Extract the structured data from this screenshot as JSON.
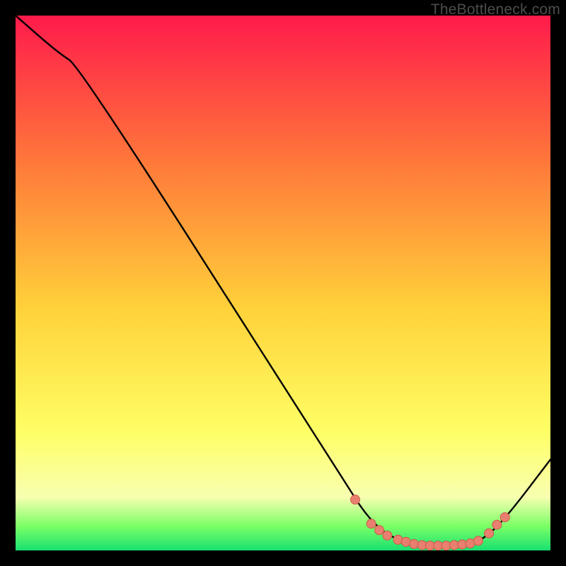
{
  "watermark": "TheBottleneck.com",
  "colors": {
    "bg": "#000000",
    "grad_top": "#ff1a4b",
    "grad_mid_upper": "#ff7a3a",
    "grad_mid": "#ffd23a",
    "grad_low": "#ffff66",
    "grad_bright": "#f8ffb0",
    "grad_green1": "#7aff66",
    "grad_green2": "#18e070",
    "curve": "#000000",
    "marker_fill": "#e9806f",
    "marker_stroke": "#c95a49"
  },
  "chart_data": {
    "type": "line",
    "title": "",
    "xlabel": "",
    "ylabel": "",
    "xlim": [
      0,
      100
    ],
    "ylim": [
      0,
      100
    ],
    "curve": [
      {
        "x": 0,
        "y": 100
      },
      {
        "x": 8,
        "y": 93
      },
      {
        "x": 12,
        "y": 90.5
      },
      {
        "x": 62,
        "y": 12
      },
      {
        "x": 66,
        "y": 6.0
      },
      {
        "x": 70,
        "y": 2.5
      },
      {
        "x": 75,
        "y": 1.0
      },
      {
        "x": 80,
        "y": 0.8
      },
      {
        "x": 85,
        "y": 1.2
      },
      {
        "x": 88,
        "y": 2.5
      },
      {
        "x": 92,
        "y": 6.5
      },
      {
        "x": 100,
        "y": 17
      }
    ],
    "markers": [
      {
        "x": 63.5,
        "y": 9.5
      },
      {
        "x": 66.5,
        "y": 5.0
      },
      {
        "x": 68.0,
        "y": 3.8
      },
      {
        "x": 69.5,
        "y": 2.8
      },
      {
        "x": 71.5,
        "y": 2.0
      },
      {
        "x": 73.0,
        "y": 1.6
      },
      {
        "x": 74.5,
        "y": 1.2
      },
      {
        "x": 76.0,
        "y": 1.0
      },
      {
        "x": 77.5,
        "y": 0.9
      },
      {
        "x": 79.0,
        "y": 0.9
      },
      {
        "x": 80.5,
        "y": 0.9
      },
      {
        "x": 82.0,
        "y": 1.0
      },
      {
        "x": 83.5,
        "y": 1.1
      },
      {
        "x": 85.0,
        "y": 1.3
      },
      {
        "x": 86.5,
        "y": 1.8
      },
      {
        "x": 88.5,
        "y": 3.2
      },
      {
        "x": 90.0,
        "y": 4.8
      },
      {
        "x": 91.5,
        "y": 6.2
      }
    ]
  }
}
